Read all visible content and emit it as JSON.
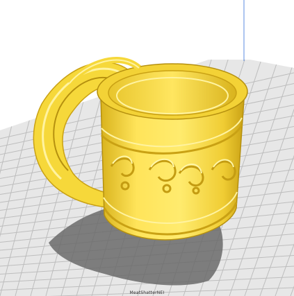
{
  "viewport": {
    "background": "#ffffff",
    "grid_fill": "#e7e7e7",
    "grid_line": "#bdbdbd",
    "axis_z_color": "#5a8be0",
    "shadow_color": "#6a6a6a",
    "model_color": "#ffe24a",
    "model_shade": "#caa417",
    "model_highlight": "#fff6a8"
  },
  "model": {
    "name": "mug"
  },
  "icons": {
    "watermark": "printer-watermark-icon"
  },
  "watermark_text": "MeatShatterNEI"
}
